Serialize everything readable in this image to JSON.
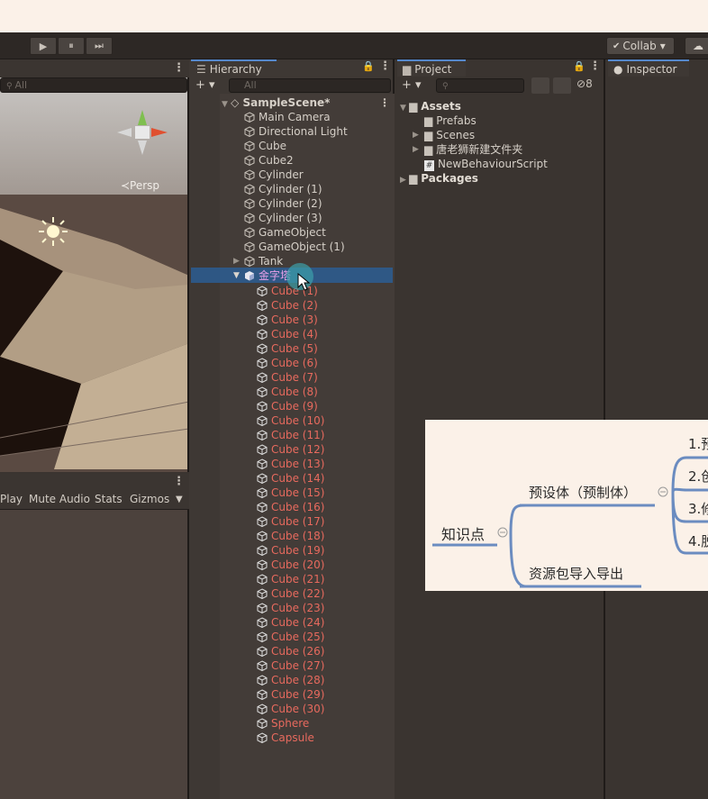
{
  "toolbar": {
    "play": "▶",
    "pause": "⏸",
    "step": "⏭",
    "collab_label": "Collab",
    "dropdown_glyph": "▾",
    "check_glyph": "✔",
    "cloud_glyph": "☁"
  },
  "scene": {
    "search_placeholder": "All",
    "persp_label": "≺Persp",
    "more": "⋮"
  },
  "game": {
    "buttons": [
      "Play",
      "Mute Audio",
      "Stats",
      "Gizmos"
    ],
    "dropdown_glyph": "▼",
    "more": "⋮"
  },
  "hierarchy": {
    "tab_label": "Hierarchy",
    "lock": "🔒",
    "more": "⋮",
    "add": "+ ▾",
    "search_placeholder": "All",
    "scene_name": "SampleScene*",
    "items": [
      "Main Camera",
      "Directional Light",
      "Cube",
      "Cube2",
      "Cylinder",
      "Cylinder (1)",
      "Cylinder (2)",
      "Cylinder (3)",
      "GameObject",
      "GameObject (1)",
      "Tank"
    ],
    "selected": "金字塔",
    "children": [
      "Cube (1)",
      "Cube (2)",
      "Cube (3)",
      "Cube (4)",
      "Cube (5)",
      "Cube (6)",
      "Cube (7)",
      "Cube (8)",
      "Cube (9)",
      "Cube (10)",
      "Cube (11)",
      "Cube (12)",
      "Cube (13)",
      "Cube (14)",
      "Cube (15)",
      "Cube (16)",
      "Cube (17)",
      "Cube (18)",
      "Cube (19)",
      "Cube (20)",
      "Cube (21)",
      "Cube (22)",
      "Cube (23)",
      "Cube (24)",
      "Cube (25)",
      "Cube (26)",
      "Cube (27)",
      "Cube (28)",
      "Cube (29)",
      "Cube (30)",
      "Sphere",
      "Capsule"
    ]
  },
  "project": {
    "tab_label": "Project",
    "add": "+ ▾",
    "hidden_count": "8",
    "assets": "Assets",
    "asset_children": [
      "Prefabs",
      "Scenes",
      "唐老狮新建文件夹",
      "NewBehaviourScript"
    ],
    "packages": "Packages"
  },
  "inspector": {
    "tab_label": "Inspector"
  },
  "mindmap": {
    "root": "知识点",
    "branch1": "预设体（预制体）",
    "branch2": "资源包导入导出",
    "leaves": [
      "1.预",
      "2.创",
      "3.修",
      "4.脱"
    ]
  },
  "colors": {
    "accent": "#5588cc",
    "selection": "#2c5d93",
    "child_text": "#e86a5e",
    "mind_line": "#6b8cc0"
  }
}
